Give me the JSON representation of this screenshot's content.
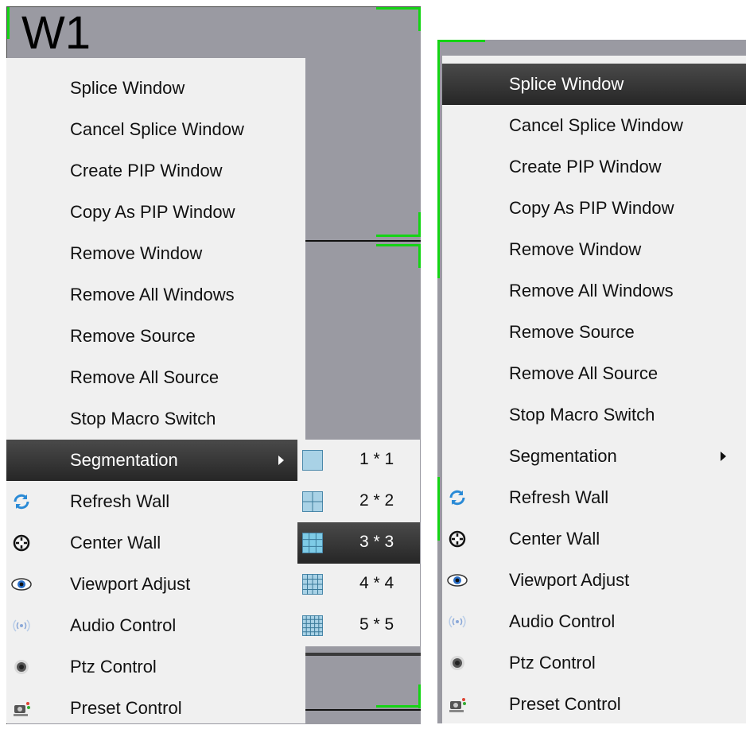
{
  "window_label": "W1",
  "context_menu": {
    "items": [
      {
        "label": "Splice Window",
        "icon": ""
      },
      {
        "label": "Cancel Splice Window",
        "icon": ""
      },
      {
        "label": "Create PIP Window",
        "icon": ""
      },
      {
        "label": "Copy As PIP Window",
        "icon": ""
      },
      {
        "label": "Remove Window",
        "icon": ""
      },
      {
        "label": "Remove All Windows",
        "icon": ""
      },
      {
        "label": "Remove Source",
        "icon": ""
      },
      {
        "label": "Remove All Source",
        "icon": ""
      },
      {
        "label": "Stop Macro Switch",
        "icon": ""
      },
      {
        "label": "Segmentation",
        "icon": "",
        "has_submenu": true
      },
      {
        "label": "Refresh Wall",
        "icon": "refresh-icon"
      },
      {
        "label": "Center Wall",
        "icon": "crosshair-icon"
      },
      {
        "label": "Viewport Adjust",
        "icon": "eye-icon"
      },
      {
        "label": "Audio Control",
        "icon": "audio-wave-icon"
      },
      {
        "label": "Ptz Control",
        "icon": "ptz-camera-icon"
      },
      {
        "label": "Preset Control",
        "icon": "preset-camera-icon"
      }
    ]
  },
  "segmentation_submenu": {
    "items": [
      {
        "label": "1 * 1",
        "icon": "grid-1x1-icon"
      },
      {
        "label": "2 * 2",
        "icon": "grid-2x2-icon"
      },
      {
        "label": "3 * 3",
        "icon": "grid-3x3-icon"
      },
      {
        "label": "4 * 4",
        "icon": "grid-4x4-icon"
      },
      {
        "label": "5 * 5",
        "icon": "grid-5x5-icon"
      }
    ],
    "highlighted": "3 * 3"
  },
  "left_highlighted": "Segmentation",
  "right_highlighted": "Splice Window",
  "colors": {
    "canvas": "#9a9aa2",
    "menu_bg": "#f0f0f0",
    "highlight": "#2e2e2e",
    "corner_marker": "#14d414"
  }
}
